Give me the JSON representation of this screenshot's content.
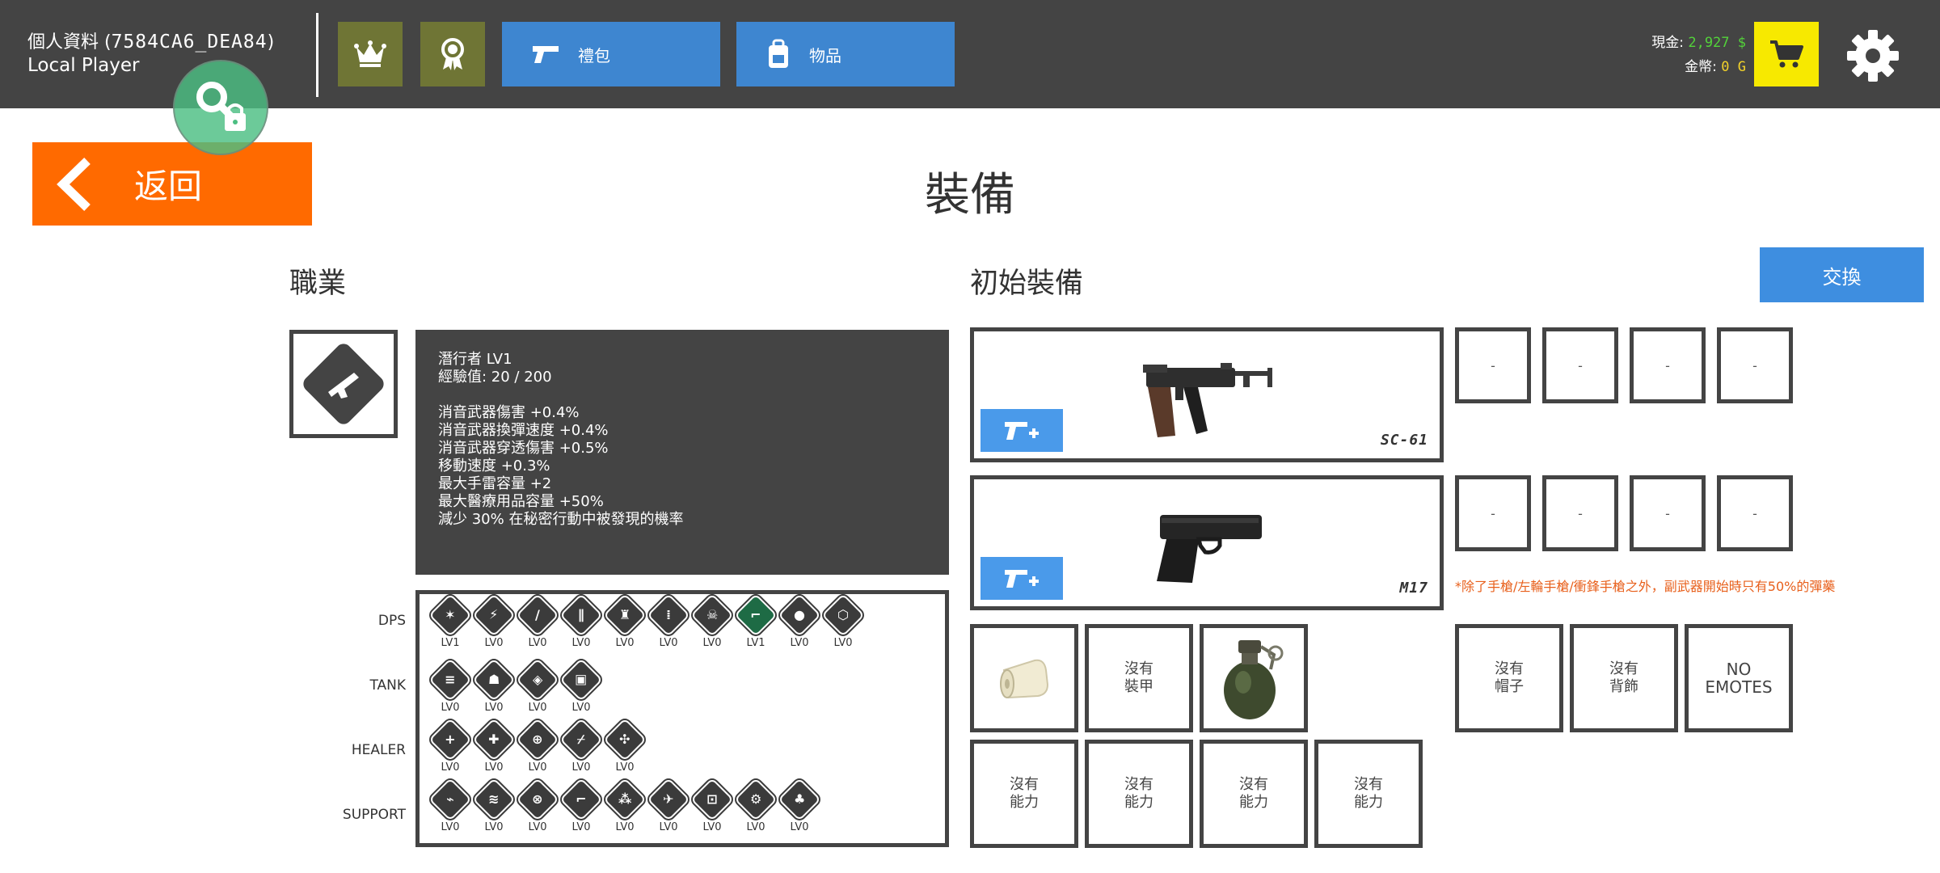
{
  "header": {
    "profile_label": "個人資料 (",
    "profile_id": "7584CA6_DEA84",
    "profile_close": ")",
    "player_name": "Local Player",
    "tabs": [
      {
        "label": "禮包",
        "icon": "pistol-icon"
      },
      {
        "label": "物品",
        "icon": "backpack-icon"
      }
    ],
    "cash_label": "現金:",
    "cash_value": "2,927 $",
    "gold_label": "金幣:",
    "gold_value": "0 G",
    "colors": {
      "bar": "#444444",
      "olive": "#6f7535",
      "tab": "#3e86d0",
      "shop": "#f7e900",
      "cash": "#53d33a",
      "gold": "#f2d22a"
    }
  },
  "back_label": "返回",
  "page_title": "裝備",
  "class_section": {
    "title": "職業",
    "info": {
      "name_line": "潛行者 LV1",
      "exp_line": "經驗值: 20 / 200",
      "bonuses": [
        "消音武器傷害 +0.4%",
        "消音武器換彈速度 +0.4%",
        "消音武器穿透傷害 +0.5%",
        "移動速度 +0.3%",
        "最大手雷容量 +2",
        "最大醫療用品容量 +50%",
        "減少 30% 在秘密行動中被發現的機率"
      ]
    },
    "roles": [
      {
        "name": "DPS",
        "skills": [
          {
            "lv": "LV1",
            "glyph": "✶",
            "active": false
          },
          {
            "lv": "LV0",
            "glyph": "⚡",
            "active": false
          },
          {
            "lv": "LV0",
            "glyph": "/",
            "active": false
          },
          {
            "lv": "LV0",
            "glyph": "∥",
            "active": false
          },
          {
            "lv": "LV0",
            "glyph": "♜",
            "active": false
          },
          {
            "lv": "LV0",
            "glyph": "⁞",
            "active": false
          },
          {
            "lv": "LV0",
            "glyph": "☠",
            "active": false
          },
          {
            "lv": "LV1",
            "glyph": "⌐",
            "active": true
          },
          {
            "lv": "LV0",
            "glyph": "●",
            "active": false
          },
          {
            "lv": "LV0",
            "glyph": "⬡",
            "active": false
          }
        ]
      },
      {
        "name": "TANK",
        "skills": [
          {
            "lv": "LV0",
            "glyph": "≡",
            "active": false
          },
          {
            "lv": "LV0",
            "glyph": "☗",
            "active": false
          },
          {
            "lv": "LV0",
            "glyph": "◈",
            "active": false
          },
          {
            "lv": "LV0",
            "glyph": "▣",
            "active": false
          }
        ]
      },
      {
        "name": "HEALER",
        "skills": [
          {
            "lv": "LV0",
            "glyph": "+",
            "active": false
          },
          {
            "lv": "LV0",
            "glyph": "✚",
            "active": false
          },
          {
            "lv": "LV0",
            "glyph": "⊕",
            "active": false
          },
          {
            "lv": "LV0",
            "glyph": "⌿",
            "active": false
          },
          {
            "lv": "LV0",
            "glyph": "✣",
            "active": false
          }
        ]
      },
      {
        "name": "SUPPORT",
        "skills": [
          {
            "lv": "LV0",
            "glyph": "⌁",
            "active": false
          },
          {
            "lv": "LV0",
            "glyph": "≋",
            "active": false
          },
          {
            "lv": "LV0",
            "glyph": "⊗",
            "active": false
          },
          {
            "lv": "LV0",
            "glyph": "⌐",
            "active": false
          },
          {
            "lv": "LV0",
            "glyph": "⁂",
            "active": false
          },
          {
            "lv": "LV0",
            "glyph": "✈",
            "active": false
          },
          {
            "lv": "LV0",
            "glyph": "⊡",
            "active": false
          },
          {
            "lv": "LV0",
            "glyph": "⚙",
            "active": false
          },
          {
            "lv": "LV0",
            "glyph": "♣",
            "active": false
          }
        ]
      }
    ]
  },
  "equip_section": {
    "title": "初始裝備",
    "swap_label": "交換",
    "primary": {
      "name": "SC-61",
      "attachments": [
        "-",
        "-",
        "-",
        "-"
      ]
    },
    "secondary": {
      "name": "M17",
      "attachments": [
        "-",
        "-",
        "-",
        "-"
      ]
    },
    "note": "*除了手槍/左輪手槍/衝鋒手槍之外，副武器開始時只有50%的彈藥",
    "gear": [
      {
        "type": "image",
        "icon": "bandage-icon"
      },
      {
        "type": "text",
        "lines": [
          "沒有",
          "裝甲"
        ]
      },
      {
        "type": "image",
        "icon": "grenade-icon"
      }
    ],
    "cosmetics": [
      {
        "lines": [
          "沒有",
          "帽子"
        ]
      },
      {
        "lines": [
          "沒有",
          "背飾"
        ]
      },
      {
        "lines": [
          "NO",
          "EMOTES"
        ]
      }
    ],
    "abilities": [
      {
        "lines": [
          "沒有",
          "能力"
        ]
      },
      {
        "lines": [
          "沒有",
          "能力"
        ]
      },
      {
        "lines": [
          "沒有",
          "能力"
        ]
      },
      {
        "lines": [
          "沒有",
          "能力"
        ]
      }
    ]
  }
}
